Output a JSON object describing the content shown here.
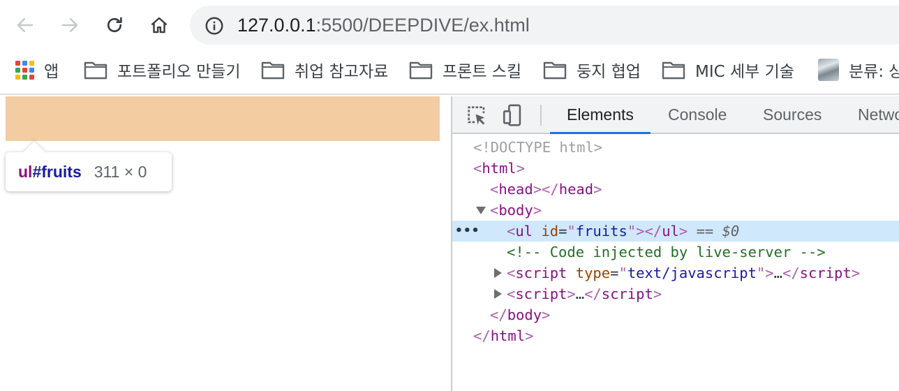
{
  "browser": {
    "url_host": "127.0.0.1",
    "url_rest": ":5500/DEEPDIVE/ex.html"
  },
  "bookmarks": [
    {
      "label": "앱",
      "icon": "apps-grid-icon"
    },
    {
      "label": "포트폴리오 만들기",
      "icon": "folder-icon"
    },
    {
      "label": "취업 참고자료",
      "icon": "folder-icon"
    },
    {
      "label": "프론트 스킬",
      "icon": "folder-icon"
    },
    {
      "label": "둥지 협업",
      "icon": "folder-icon"
    },
    {
      "label": "MIC 세부 기술",
      "icon": "folder-icon"
    },
    {
      "label": "분류: 상",
      "icon": "thumbnail-icon"
    }
  ],
  "colors": {
    "highlight": "#f3cca2",
    "active_tab_underline": "#1a73e8",
    "selected_row": "#cfe8fc"
  },
  "inspect_tooltip": {
    "tag": "ul",
    "id": "#fruits",
    "size": "311 × 0"
  },
  "devtools": {
    "tabs": [
      "Elements",
      "Console",
      "Sources",
      "Network"
    ],
    "active_tab": "Elements",
    "dom": {
      "doctype": "<!DOCTYPE html>",
      "html_open_tag": "html",
      "head_tag": "head",
      "body_tag": "body",
      "ul_tag": "ul",
      "ul_attr_name": "id",
      "ul_attr_value": "fruits",
      "selected_suffix": "== ",
      "selected_var": "$0",
      "comment": "<!-- Code injected by live-server -->",
      "script_tag": "script",
      "script_attr_name": "type",
      "script_attr_value": "text/javascript",
      "collapsed_content": "…"
    }
  }
}
